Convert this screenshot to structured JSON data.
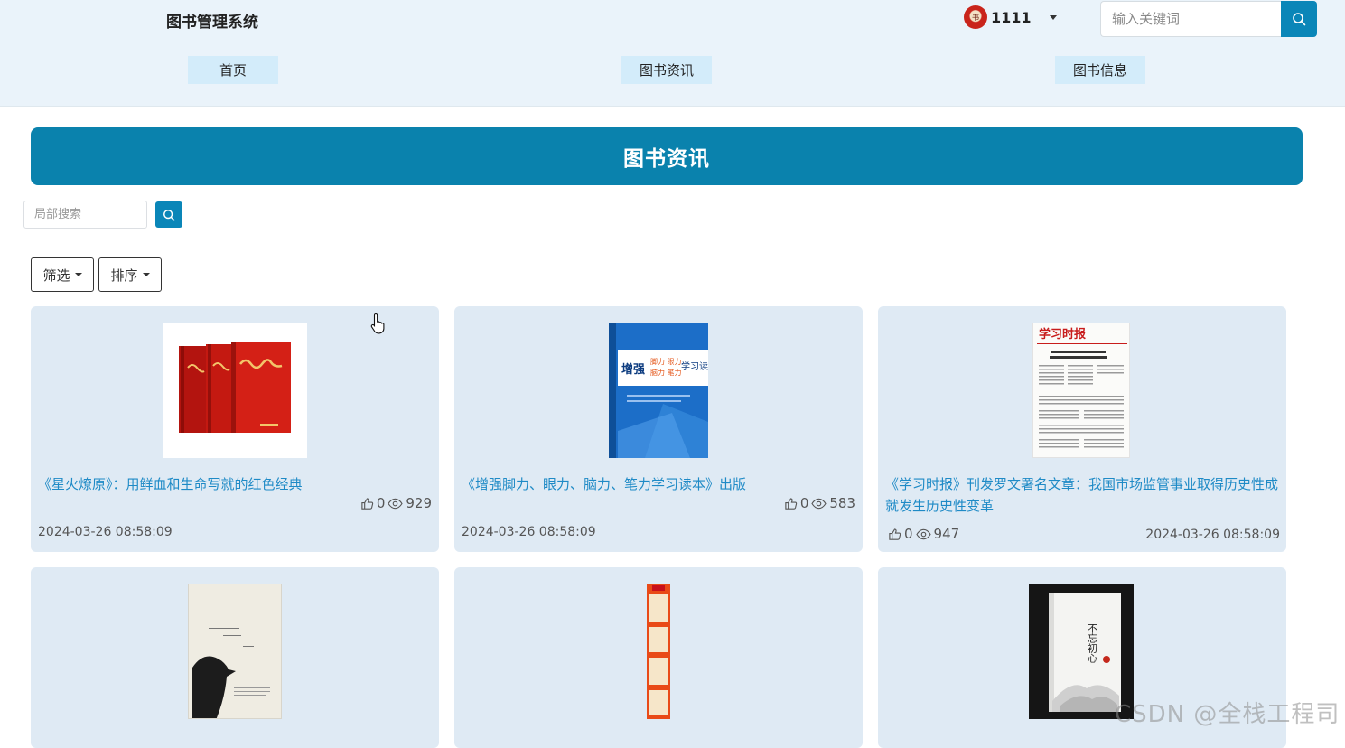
{
  "header": {
    "brand": "图书管理系统",
    "user": {
      "name": "1111",
      "avatar_text": "书"
    },
    "search": {
      "placeholder": "输入关键词"
    },
    "nav": [
      {
        "label": "首页"
      },
      {
        "label": "图书资讯"
      },
      {
        "label": "图书信息"
      }
    ]
  },
  "banner": {
    "title": "图书资讯"
  },
  "filters": {
    "local_search_placeholder": "局部搜索",
    "filter_label": "筛选",
    "sort_label": "排序"
  },
  "cards": [
    {
      "title": "《星火燎原》：用鲜血和生命写就的红色经典",
      "likes": "0",
      "views": "929",
      "date": "2024-03-26 08:58:09"
    },
    {
      "title": "《增强脚力、眼力、脑力、笔力学习读本》出版",
      "likes": "0",
      "views": "583",
      "date": "2024-03-26 08:58:09",
      "cover_text": "增强 脚力 眼力 脑力 笔力 学习读本"
    },
    {
      "title": "《学习时报》刊发罗文署名文章：我国市场监管事业取得历史性成就发生历史性变革",
      "likes": "0",
      "views": "947",
      "date": "2024-03-26 08:58:09",
      "cover_text": "学习时报"
    },
    {
      "title": "",
      "cover_text": ""
    },
    {
      "title": "",
      "cover_text": ""
    },
    {
      "title": "",
      "cover_text": "不忘初心"
    }
  ],
  "watermark": "CSDN @全栈工程司"
}
